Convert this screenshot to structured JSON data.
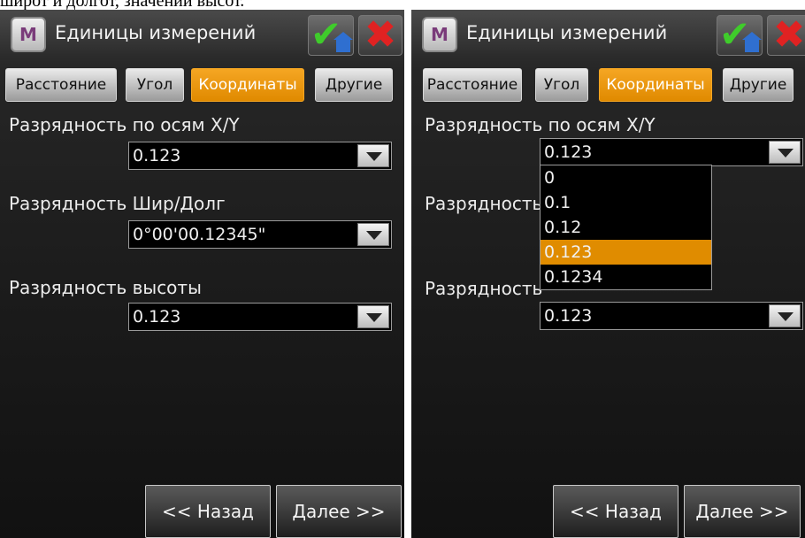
{
  "caption": "широт и долгот, значений высот.",
  "left_screen": {
    "title": "Единицы измерений",
    "app_icon_letter": "M",
    "tabs": [
      "Расстояние",
      "Угол",
      "Координаты",
      "Другие"
    ],
    "active_tab": "Координаты",
    "fields": [
      {
        "label": "Разрядность по осям X/Y",
        "value": "0.123"
      },
      {
        "label": "Разрядность Шир/Долг",
        "value": "0°00'00.12345\""
      },
      {
        "label": "Разрядность высоты",
        "value": "0.123"
      }
    ],
    "back_label": "<< Назад",
    "next_label": "Далее >>"
  },
  "right_screen": {
    "title": "Единицы измерений",
    "app_icon_letter": "M",
    "tabs": [
      "Расстояние",
      "Угол",
      "Координаты",
      "Другие"
    ],
    "active_tab": "Координаты",
    "fields": [
      {
        "label": "Разрядность по осям X/Y",
        "value": "0.123"
      },
      {
        "label": "Разрядность",
        "value": ""
      },
      {
        "label": "Разрядность",
        "value": "0.123"
      }
    ],
    "dropdown_options": [
      "0",
      "0.1",
      "0.12",
      "0.123",
      "0.1234"
    ],
    "dropdown_selected": "0.123",
    "back_label": "<< Назад",
    "next_label": "Далее >>"
  },
  "colors": {
    "accent": "#e08c00",
    "confirm_check": "#3fcc2b",
    "cancel_x": "#e02222",
    "background": "#1c1c1c"
  },
  "icons": {
    "app": "app-m-icon",
    "confirm": "checkmark-home-icon",
    "cancel": "close-x-icon",
    "dropdown": "chevron-down-icon"
  }
}
